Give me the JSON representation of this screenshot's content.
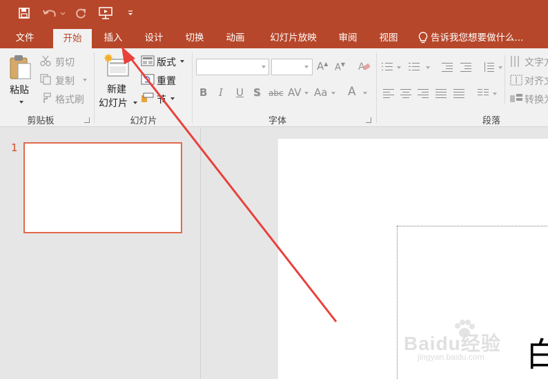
{
  "quick_access": {
    "save_icon": "save-icon",
    "undo_icon": "undo-icon",
    "redo_icon": "redo-icon",
    "present_icon": "start-from-beginning-icon",
    "customize_icon": "customize-qat-icon"
  },
  "tabs": [
    {
      "label": "文件"
    },
    {
      "label": "开始"
    },
    {
      "label": "插入"
    },
    {
      "label": "设计"
    },
    {
      "label": "切换"
    },
    {
      "label": "动画"
    },
    {
      "label": "幻灯片放映"
    },
    {
      "label": "审阅"
    },
    {
      "label": "视图"
    }
  ],
  "active_tab": "开始",
  "tell_me": "告诉我您想要做什么...",
  "ribbon": {
    "clipboard": {
      "label": "剪贴板",
      "paste": "粘贴",
      "cut": "剪切",
      "copy": "复制",
      "format_painter": "格式刷"
    },
    "slides": {
      "label": "幻灯片",
      "new_slide_line1": "新建",
      "new_slide_line2": "幻灯片",
      "layout": "版式",
      "reset": "重置",
      "section": "节"
    },
    "font": {
      "label": "字体",
      "font_name": "",
      "font_size": "",
      "bold": "B",
      "italic": "I",
      "underline": "U",
      "shadow": "S",
      "strikethrough": "abc",
      "char_spacing": "AV",
      "change_case": "Aa",
      "font_color": "A"
    },
    "paragraph": {
      "label": "段落",
      "text_direction": "文字方",
      "align_text": "对齐文",
      "convert": "转换为"
    }
  },
  "slides_panel": {
    "slide_number": "1"
  },
  "canvas": {
    "partial_char": "白"
  },
  "watermark": {
    "logo": "Baidu经验",
    "url": "jingyan.baidu.com"
  },
  "colors": {
    "accent": "#b7472a",
    "ribbon_bg": "#f1f1f1",
    "thumb_border": "#e0694a",
    "arrow": "#e8413c"
  }
}
